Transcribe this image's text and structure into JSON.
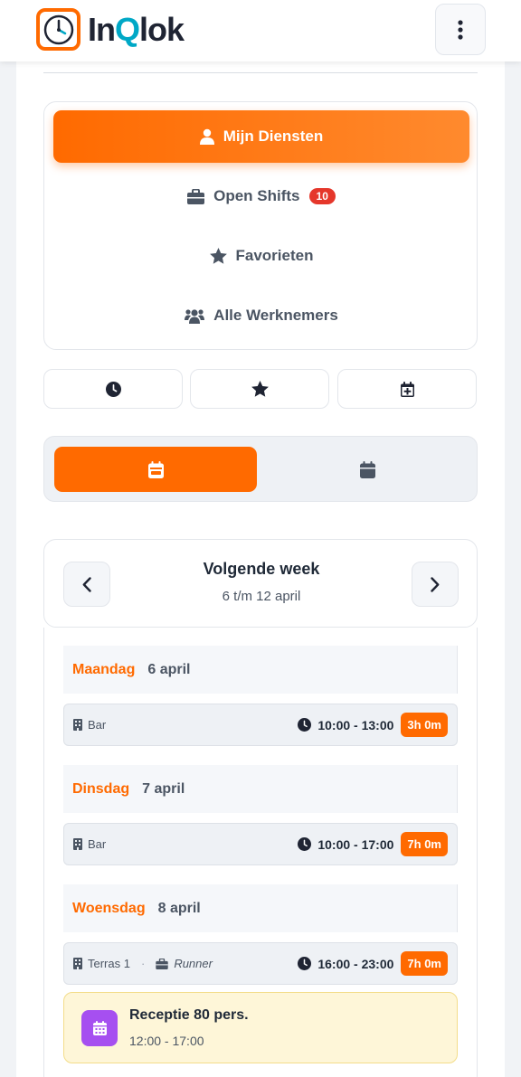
{
  "app": {
    "logo_text_1": "In",
    "logo_text_q": "Q",
    "logo_text_2": "lok"
  },
  "nav": {
    "items": [
      {
        "label": "Mijn Diensten",
        "icon": "user-icon"
      },
      {
        "label": "Open Shifts",
        "icon": "briefcase-icon",
        "badge": "10"
      },
      {
        "label": "Favorieten",
        "icon": "star-icon"
      },
      {
        "label": "Alle Werknemers",
        "icon": "users-icon"
      }
    ],
    "active_index": 0
  },
  "quick_actions": [
    "clock-icon",
    "star-icon",
    "calendar-plus-icon"
  ],
  "view_toggle": {
    "active": "calendar-week-icon",
    "inactive": "calendar-icon"
  },
  "week": {
    "title": "Volgende week",
    "range": "6 t/m 12 april"
  },
  "days": [
    {
      "name": "Maandag",
      "date": "6 april",
      "shifts": [
        {
          "location": "Bar",
          "time": "10:00 - 13:00",
          "duration": "3h 0m"
        }
      ]
    },
    {
      "name": "Dinsdag",
      "date": "7 april",
      "shifts": [
        {
          "location": "Bar",
          "time": "10:00 - 17:00",
          "duration": "7h 0m"
        }
      ]
    },
    {
      "name": "Woensdag",
      "date": "8 april",
      "shifts": [
        {
          "location": "Terras 1",
          "separator": "·",
          "role": "Runner",
          "time": "16:00 - 23:00",
          "duration": "7h 0m"
        }
      ]
    }
  ],
  "event": {
    "title": "Receptie 80 pers.",
    "time": "12:00 - 17:00"
  },
  "colors": {
    "accent": "#ff6a00",
    "badge": "#e5372b",
    "event_bg": "#fef6d8",
    "event_icon": "#a64ff0",
    "logo_q": "#00a8c6"
  }
}
